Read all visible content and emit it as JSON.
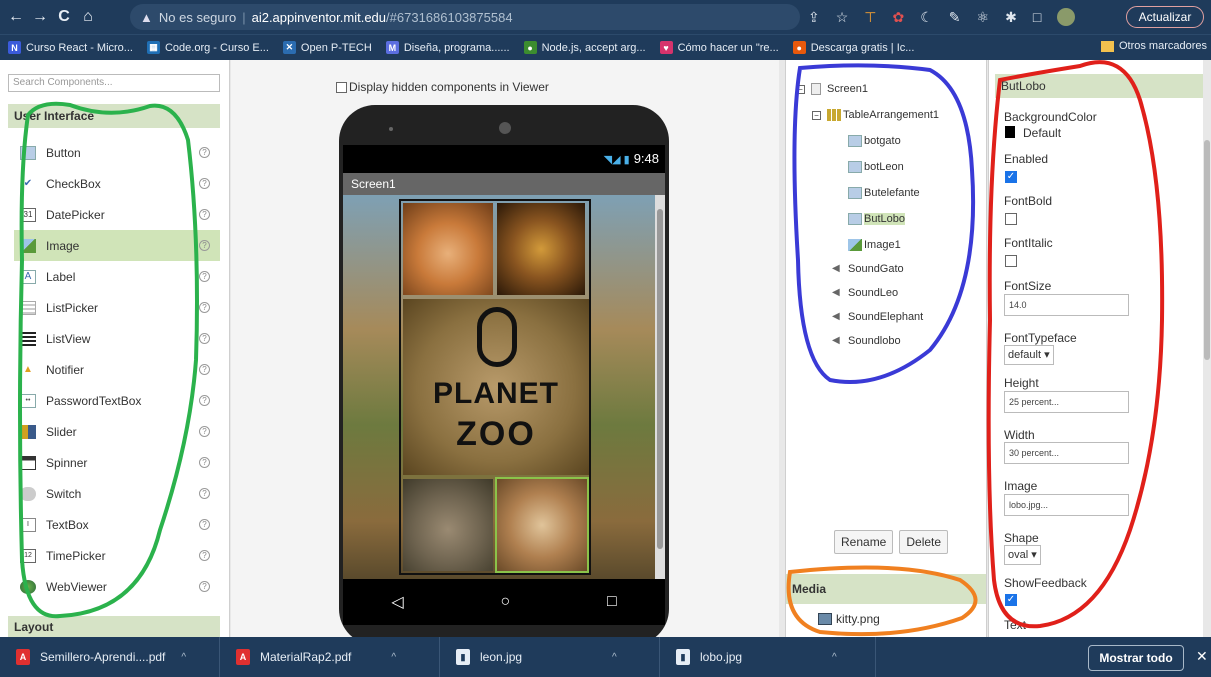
{
  "browser": {
    "nav": [
      "←",
      "→",
      "C",
      "⌂"
    ],
    "insecure_label": "No es seguro",
    "host": "ai2.appinventor.mit.edu",
    "path": "/#6731686103875584",
    "update_label": "Actualizar"
  },
  "bookmarks": [
    {
      "label": "Curso React - Micro...",
      "color": "#3b5bdb",
      "glyph": "N"
    },
    {
      "label": "Code.org - Curso E...",
      "color": "#1f6fb5",
      "glyph": "▦"
    },
    {
      "label": "Open P-TECH",
      "color": "#2b6cb0",
      "glyph": "✕"
    },
    {
      "label": "Diseña, programa......",
      "color": "#5b6ee1",
      "glyph": "M"
    },
    {
      "label": "Node.js, accept arg...",
      "color": "#3c8d2f",
      "glyph": "●"
    },
    {
      "label": "Cómo hacer un \"re...",
      "color": "#d6336c",
      "glyph": "♥"
    },
    {
      "label": "Descarga gratis | Ic...",
      "color": "#e8590c",
      "glyph": "●"
    }
  ],
  "bookmarks_other": "Otros marcadores",
  "palette": {
    "search_placeholder": "Search Components...",
    "category": "User Interface",
    "components": [
      {
        "label": "Button",
        "icon": "button-icon"
      },
      {
        "label": "CheckBox",
        "icon": "checkbox-icon"
      },
      {
        "label": "DatePicker",
        "icon": "datepicker-icon"
      },
      {
        "label": "Image",
        "icon": "image-icon",
        "selected": true
      },
      {
        "label": "Label",
        "icon": "label-icon"
      },
      {
        "label": "ListPicker",
        "icon": "listpicker-icon"
      },
      {
        "label": "ListView",
        "icon": "listview-icon"
      },
      {
        "label": "Notifier",
        "icon": "notifier-icon"
      },
      {
        "label": "PasswordTextBox",
        "icon": "password-icon"
      },
      {
        "label": "Slider",
        "icon": "slider-icon"
      },
      {
        "label": "Spinner",
        "icon": "spinner-icon"
      },
      {
        "label": "Switch",
        "icon": "switch-icon"
      },
      {
        "label": "TextBox",
        "icon": "textbox-icon"
      },
      {
        "label": "TimePicker",
        "icon": "timepicker-icon"
      },
      {
        "label": "WebViewer",
        "icon": "webviewer-icon"
      }
    ],
    "layout_category": "Layout",
    "help_glyph": "?"
  },
  "viewer": {
    "hidden_label": "Display hidden components in Viewer",
    "status_time": "9:48",
    "status_icons": "◥◢ ▮",
    "screen_title": "Screen1",
    "banner_line1": "PLANET",
    "banner_line2": "ZOO",
    "nav_buttons": [
      "◁",
      "○",
      "□"
    ]
  },
  "tree": {
    "screen": "Screen1",
    "table": "TableArrangement1",
    "children": [
      "botgato",
      "botLeon",
      "Butelefante",
      "ButLobo",
      "Image1"
    ],
    "sounds": [
      "SoundGato",
      "SoundLeo",
      "SoundElephant",
      "Soundlobo"
    ],
    "selected": "ButLobo",
    "rename_label": "Rename",
    "delete_label": "Delete",
    "media_title": "Media",
    "media_item": "kitty.png",
    "collapse_glyph": "⊟"
  },
  "props": {
    "title": "ButLobo",
    "background_label": "BackgroundColor",
    "background_value": "Default",
    "enabled_label": "Enabled",
    "fontbold_label": "FontBold",
    "fontitalic_label": "FontItalic",
    "fontsize_label": "FontSize",
    "fontsize_value": "14.0",
    "typeface_label": "FontTypeface",
    "typeface_value": "default ▾",
    "height_label": "Height",
    "height_value": "25 percent...",
    "width_label": "Width",
    "width_value": "30 percent...",
    "image_label": "Image",
    "image_value": "lobo.jpg...",
    "shape_label": "Shape",
    "shape_value": "oval ▾",
    "feedback_label": "ShowFeedback",
    "text_label": "Text",
    "check": "✓"
  },
  "downloads": {
    "items": [
      {
        "label": "Semillero-Aprendi....pdf",
        "type": "pdf"
      },
      {
        "label": "MaterialRap2.pdf",
        "type": "pdf"
      },
      {
        "label": "leon.jpg",
        "type": "img"
      },
      {
        "label": "lobo.jpg",
        "type": "img"
      }
    ],
    "caret": "^",
    "show_all": "Mostrar todo",
    "close": "✕"
  },
  "colors": {
    "chrome": "#1f3b5b",
    "selection": "#d0e4b8",
    "green_annotation": "#2bb24c",
    "blue_annotation": "#3a3ad6",
    "red_annotation": "#e0201a",
    "orange_annotation": "#f08020"
  }
}
